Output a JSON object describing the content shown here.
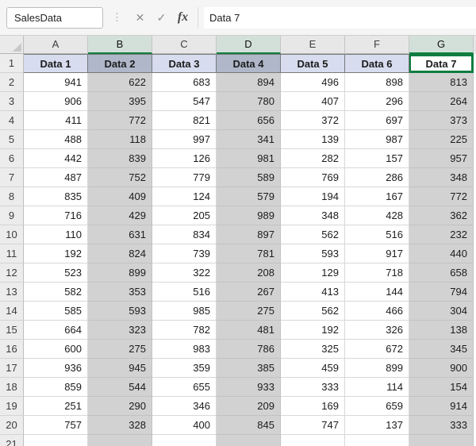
{
  "formula_bar": {
    "name_box": "SalesData",
    "content": "Data 7",
    "icons": {
      "separator": "⋮",
      "cancel": "✕",
      "enter": "✓",
      "fx": "fx"
    }
  },
  "grid": {
    "column_letters": [
      "A",
      "B",
      "C",
      "D",
      "E",
      "F",
      "G"
    ],
    "selected_columns": [
      "B",
      "D",
      "G"
    ],
    "active_cell": "G1",
    "row_numbers": [
      "1",
      "2",
      "3",
      "4",
      "5",
      "6",
      "7",
      "8",
      "9",
      "10",
      "11",
      "12",
      "13",
      "14",
      "15",
      "16",
      "17",
      "18",
      "19",
      "20"
    ],
    "header_row": [
      "Data 1",
      "Data 2",
      "Data 3",
      "Data 4",
      "Data 5",
      "Data 6",
      "Data 7"
    ],
    "data_rows": [
      [
        941,
        622,
        683,
        894,
        496,
        898,
        813
      ],
      [
        906,
        395,
        547,
        780,
        407,
        296,
        264
      ],
      [
        411,
        772,
        821,
        656,
        372,
        697,
        373
      ],
      [
        488,
        118,
        997,
        341,
        139,
        987,
        225
      ],
      [
        442,
        839,
        126,
        981,
        282,
        157,
        957
      ],
      [
        487,
        752,
        779,
        589,
        769,
        286,
        348
      ],
      [
        835,
        409,
        124,
        579,
        194,
        167,
        772
      ],
      [
        716,
        429,
        205,
        989,
        348,
        428,
        362
      ],
      [
        110,
        631,
        834,
        897,
        562,
        516,
        232
      ],
      [
        192,
        824,
        739,
        781,
        593,
        917,
        440
      ],
      [
        523,
        899,
        322,
        208,
        129,
        718,
        658
      ],
      [
        582,
        353,
        516,
        267,
        413,
        144,
        794
      ],
      [
        585,
        593,
        985,
        275,
        562,
        466,
        304
      ],
      [
        664,
        323,
        782,
        481,
        192,
        326,
        138
      ],
      [
        600,
        275,
        983,
        786,
        325,
        672,
        345
      ],
      [
        936,
        945,
        359,
        385,
        459,
        899,
        900
      ],
      [
        859,
        544,
        655,
        933,
        333,
        114,
        154
      ],
      [
        251,
        290,
        346,
        209,
        169,
        659,
        914
      ],
      [
        757,
        328,
        400,
        845,
        747,
        137,
        333
      ]
    ]
  },
  "colors": {
    "accent_green": "#107C41",
    "selected_cell_fill": "#D2D2D2",
    "header_row_fill": "#D7DDEF",
    "selected_header_row_fill": "#AFB7C9",
    "selected_column_header_fill": "#D3E0D9"
  }
}
